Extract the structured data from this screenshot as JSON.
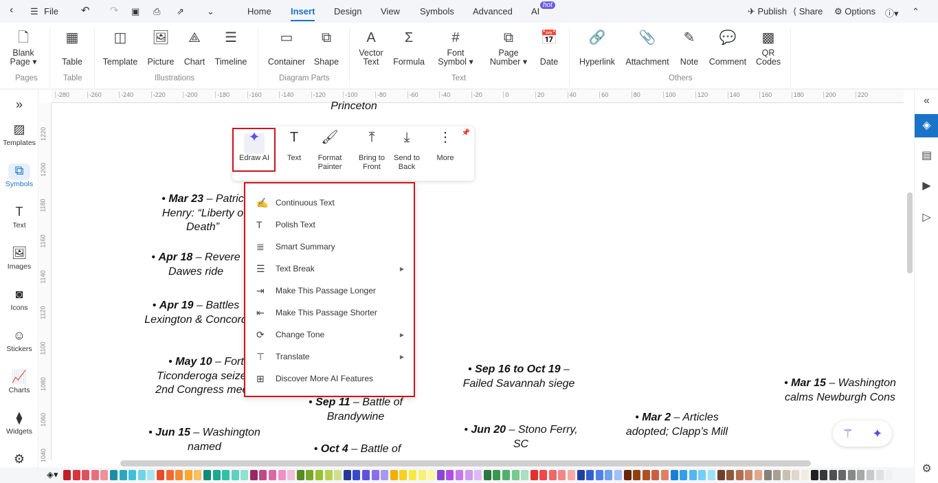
{
  "topbar": {
    "file": "File",
    "tabs": [
      "Home",
      "Insert",
      "Design",
      "View",
      "Symbols",
      "Advanced",
      "AI"
    ],
    "hot_badge": "hot",
    "publish": "Publish",
    "share": "Share",
    "options": "Options"
  },
  "ribbon": {
    "items": [
      {
        "label": "Blank Page",
        "icon": "blank-page-icon"
      },
      {
        "label": "Table",
        "icon": "table-icon"
      },
      {
        "label": "Template",
        "icon": "template-icon"
      },
      {
        "label": "Picture",
        "icon": "picture-icon"
      },
      {
        "label": "Chart",
        "icon": "chart-icon"
      },
      {
        "label": "Timeline",
        "icon": "timeline-icon"
      },
      {
        "label": "Container",
        "icon": "container-icon"
      },
      {
        "label": "Shape",
        "icon": "shape-icon"
      },
      {
        "label": "Vector Text",
        "icon": "vector-text-icon"
      },
      {
        "label": "Formula",
        "icon": "formula-icon"
      },
      {
        "label": "Font Symbol",
        "icon": "hash-icon"
      },
      {
        "label": "Page Number",
        "icon": "page-number-icon"
      },
      {
        "label": "Date",
        "icon": "date-icon"
      },
      {
        "label": "Hyperlink",
        "icon": "hyperlink-icon"
      },
      {
        "label": "Attachment",
        "icon": "attachment-icon"
      },
      {
        "label": "Note",
        "icon": "note-icon"
      },
      {
        "label": "Comment",
        "icon": "comment-icon"
      },
      {
        "label": "QR Codes",
        "icon": "qr-icon"
      }
    ],
    "groups": [
      "Pages",
      "Table",
      "Illustrations",
      "Diagram Parts",
      "Text",
      "Others"
    ]
  },
  "ruler": {
    "h": [
      "-280",
      "-260",
      "-240",
      "-220",
      "-200",
      "-180",
      "-160",
      "-140",
      "-120",
      "-100",
      "-80",
      "-60",
      "-40",
      "-20",
      "0",
      "20",
      "40",
      "60",
      "80",
      "100",
      "120",
      "140",
      "160",
      "180",
      "200",
      "220"
    ],
    "v": [
      "1220",
      "1200",
      "1180",
      "1160",
      "1140",
      "1120",
      "1100",
      "1080",
      "1060",
      "1040"
    ]
  },
  "sidebar": {
    "items": [
      "Templates",
      "Symbols",
      "Text",
      "Images",
      "Icons",
      "Stickers",
      "Charts",
      "Widgets"
    ],
    "active": "Symbols"
  },
  "canvas": {
    "entries": [
      {
        "date": "",
        "text": "Princeton"
      },
      {
        "date": "Mar 23",
        "text": " – Patric Henry: “Liberty o Death”"
      },
      {
        "date": "Apr 18",
        "text": " – Revere Dawes ride"
      },
      {
        "date": "Apr 19",
        "text": " – Battles Lexington & Concord"
      },
      {
        "date": "May 10",
        "text": " – Fort Ticonderoga seized; 2nd Congress meets"
      },
      {
        "date": "Jun 15",
        "text": " – Washington named"
      },
      {
        "date": "Sep 11",
        "text": " – Battle of Brandywine"
      },
      {
        "date": "Oct 4",
        "text": " – Battle of"
      },
      {
        "date": "Sep 16 to Oct 19",
        "text": " – Failed Savannah siege"
      },
      {
        "date": "Jun 20",
        "text": " – Stono Ferry, SC"
      },
      {
        "date": "Mar 2",
        "text": " – Articles adopted; Clapp’s Mill"
      },
      {
        "date": "Mar 15",
        "text": " – Washington calms Newburgh Cons"
      }
    ]
  },
  "floating_toolbar": {
    "items": [
      "Edraw AI",
      "Text",
      "Format Painter",
      "Bring to Front",
      "Send to Back",
      "More"
    ]
  },
  "ai_menu": {
    "items": [
      {
        "label": "Continuous Text",
        "submenu": false
      },
      {
        "label": "Polish Text",
        "submenu": false
      },
      {
        "label": "Smart Summary",
        "submenu": false
      },
      {
        "label": "Text Break",
        "submenu": true
      },
      {
        "label": "Make This Passage Longer",
        "submenu": false
      },
      {
        "label": "Make This Passage Shorter",
        "submenu": false
      },
      {
        "label": "Change Tone",
        "submenu": true
      },
      {
        "label": "Translate",
        "submenu": true
      },
      {
        "label": "Discover More AI Features",
        "submenu": false
      }
    ]
  },
  "highlight_color": "#c8161e",
  "accent_color": "#1a73c8",
  "palette": [
    "#c0202a",
    "#d8343e",
    "#e0505a",
    "#ea6f7a",
    "#f0909a",
    "#1b8fa0",
    "#2aa8c0",
    "#40c0d8",
    "#70d4e8",
    "#a8e4f0",
    "#e84a2a",
    "#f06a30",
    "#f58a30",
    "#f8a830",
    "#f8c060",
    "#128a78",
    "#1aa890",
    "#30c0a8",
    "#60d0c0",
    "#90e0d0",
    "#9a2860",
    "#c04888",
    "#d868a8",
    "#f090c8",
    "#f0c0d8",
    "#5a8a20",
    "#78a828",
    "#98c030",
    "#b8d050",
    "#d0e090",
    "#283898",
    "#3848c8",
    "#6050e0",
    "#8870e8",
    "#a898f0",
    "#f0b000",
    "#f8d020",
    "#f8e840",
    "#f8f070",
    "#fff8a0",
    "#8848d0",
    "#b050e0",
    "#c878e8",
    "#d098f0",
    "#e0b8f8",
    "#287840",
    "#389850",
    "#50b068",
    "#78c890",
    "#a8e0c0",
    "#e03030",
    "#f04848",
    "#f06868",
    "#f08888",
    "#f8a8a8",
    "#2040a0",
    "#3060d0",
    "#5080e8",
    "#70a0f0",
    "#a0c0f8",
    "#6a2808",
    "#904010",
    "#b05020",
    "#c86040",
    "#e08060",
    "#1880d0",
    "#30a0e8",
    "#50b8f0",
    "#70d0f8",
    "#a0e0f8",
    "#704028",
    "#905838",
    "#b07050",
    "#c88868",
    "#e0a888",
    "#888078",
    "#a8a090",
    "#c8c0b0",
    "#e0d8c8",
    "#f0ece0",
    "#202020",
    "#383838",
    "#505050",
    "#686868",
    "#888888",
    "#a8a8a8",
    "#c8c8c8",
    "#e0e0e0",
    "#f0f0f0"
  ]
}
